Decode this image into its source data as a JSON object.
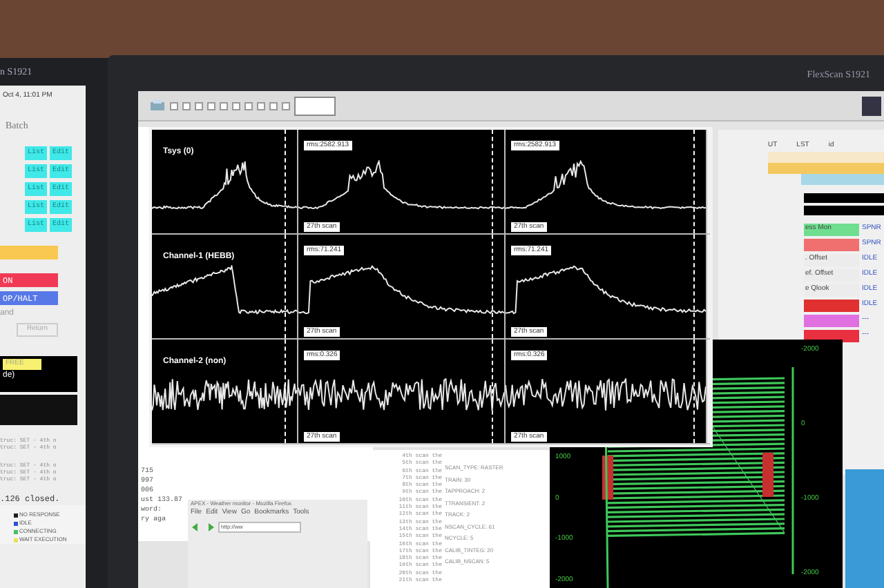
{
  "monitors": [
    {
      "brand": "n S1921"
    },
    {
      "brand": "FlexScan S1921"
    }
  ],
  "left_panel": {
    "clock": "Oct 4, 11:01 PM",
    "menu": "Batch",
    "rows": [
      {
        "list": "List",
        "edit": "Edit"
      },
      {
        "list": "List",
        "edit": "Edit"
      },
      {
        "list": "List",
        "edit": "Edit"
      },
      {
        "list": "List",
        "edit": "Edit"
      },
      {
        "list": "List",
        "edit": "Edit"
      }
    ],
    "buttons": [
      {
        "label": "ON",
        "color": "#f03a55"
      },
      {
        "label": "OP/HALT",
        "color": "#5878e8"
      }
    ],
    "section": "and",
    "return_button": "Return",
    "badge": "FREE",
    "mode": "de)",
    "log": [
      "truc: SET - 4th o",
      "truc: SET - 4th o",
      "truc: SET - 4th o",
      "truc: SET - 4th o",
      "truc: SET - 4th o"
    ],
    "closed": ".126 closed.",
    "legend": [
      {
        "label": "NO RESPONSE",
        "color": "#202020"
      },
      {
        "label": "IDLE",
        "color": "#3050d0"
      },
      {
        "label": "CONNECTING",
        "color": "#40c060"
      },
      {
        "label": "WAIT EXECUTION",
        "color": "#e8e060"
      }
    ]
  },
  "plot_window": {
    "rows": [
      {
        "title": "Tsys (0)",
        "kind": "peak",
        "labels": [
          "rms:2582.913",
          "rms:2582.913"
        ],
        "footers": [
          "27th scan",
          "27th scan"
        ]
      },
      {
        "title": "Channel-1 (HEBB)",
        "kind": "plateau",
        "labels": [
          "rms:71.241",
          "rms:71.241"
        ],
        "footers": [
          "27th scan",
          "27th scan"
        ]
      },
      {
        "title": "Channel-2 (non)",
        "kind": "noise",
        "labels": [
          "rms:0.326",
          "rms:0.326"
        ],
        "footers": [
          "27th scan",
          "27th scan"
        ]
      }
    ]
  },
  "status_panel": {
    "columns": [
      "UT",
      "LST",
      "id"
    ],
    "rows": [
      {
        "name": "ess Mon",
        "status": "SPNR",
        "color": "#6fdf8f"
      },
      {
        "status": "SPNR",
        "color": "#f07070"
      },
      {
        "name": ". Offset",
        "status": "IDLE",
        "color": "#ececec"
      },
      {
        "name": "ef. Offset",
        "status": "IDLE",
        "color": "#ececec"
      },
      {
        "name": "e Qlook",
        "status": "IDLE",
        "color": "#ececec"
      },
      {
        "status": "IDLE",
        "color": "#e03030"
      },
      {
        "status": "---",
        "color": "#e070e0"
      },
      {
        "status": "---",
        "color": "#e83040"
      }
    ]
  },
  "terminal": {
    "lines": [
      "715",
      "997",
      "006",
      "ust 133.87",
      "word:",
      "ry aga"
    ]
  },
  "browser": {
    "title": "APEX - Weather monitor - Mozilla Firefox",
    "menu": [
      "File",
      "Edit",
      "View",
      "Go",
      "Bookmarks",
      "Tools"
    ],
    "url": "http://ww"
  },
  "scan_list": [
    "4th scan the",
    "5th scan the",
    "6th scan the",
    "7th scan the",
    "8th scan the",
    "9th scan the",
    "10th scan the",
    "11th scan the",
    "12th scan the",
    "13th scan the",
    "14th scan the",
    "15th scan the",
    "16th scan the",
    "17th scan the",
    "18th scan the",
    "19th scan the",
    "20th scan the",
    "21th scan the"
  ],
  "parameters": [
    "SCAN_TYPE: RASTER",
    "TRAIN: 30",
    "TAPPROACH: 2",
    "TTRANSIENT: 2",
    "TRACK: 2",
    "NSCAN_CYCLE: 61",
    "NCYCLE: 5",
    "CALIB_TINTEG: 20",
    "CALIB_NSCAN: 5"
  ],
  "raster_plot": {
    "left_ticks": [
      "1000",
      "0",
      "-1000",
      "-2000"
    ],
    "right_ticks": [
      "-2000",
      "0",
      "-1000",
      "-2000"
    ]
  }
}
